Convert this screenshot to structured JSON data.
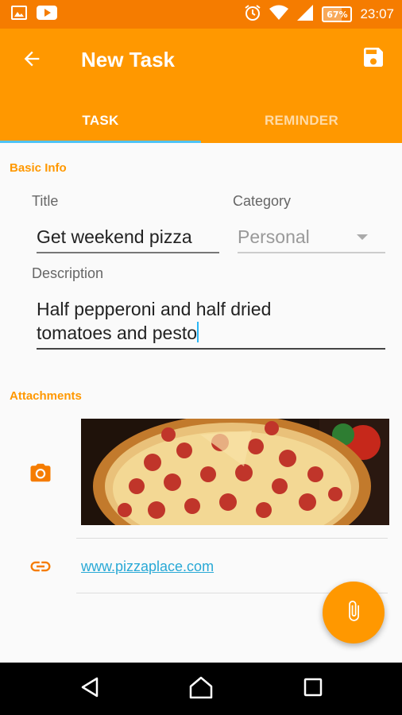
{
  "status_bar": {
    "time": "23:07",
    "battery_percent": "67%",
    "battery_level": 0.67,
    "left_icons": [
      "image-icon",
      "youtube-icon"
    ],
    "right_icons": [
      "alarm-icon",
      "wifi-icon",
      "signal-icon"
    ]
  },
  "app_bar": {
    "title": "New Task",
    "background": "#ff9800",
    "status_color": "#f57c00"
  },
  "tabs": [
    {
      "label": "TASK",
      "active": true
    },
    {
      "label": "REMINDER",
      "active": false
    }
  ],
  "basic_info": {
    "section_label": "Basic Info",
    "title_label": "Title",
    "title_value": "Get weekend pizza",
    "category_label": "Category",
    "category_value": "Personal",
    "description_label": "Description",
    "description_line1": "Half pepperoni and half dried",
    "description_line2": "tomatoes and pesto"
  },
  "attachments": {
    "section_label": "Attachments",
    "link": "www.pizzaplace.com"
  },
  "colors": {
    "accent": "#ff9800",
    "link": "#29a9d6",
    "tab_indicator": "#4fc3f7"
  }
}
